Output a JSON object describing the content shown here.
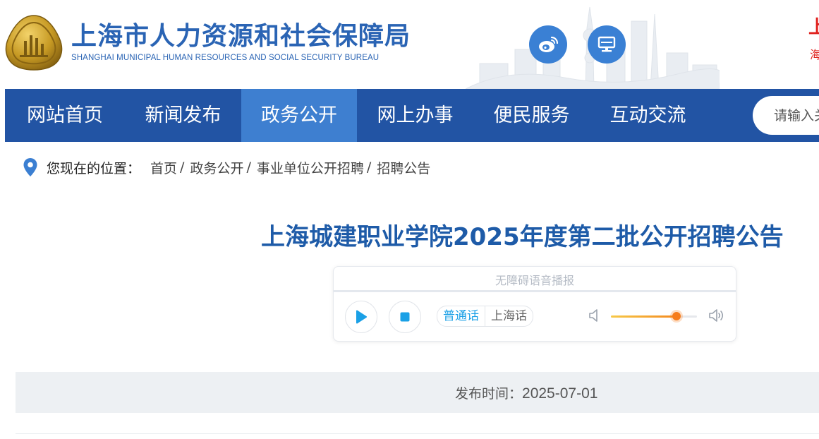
{
  "header": {
    "title_cn": "上海市人力资源和社会保障局",
    "title_en": "SHANGHAI MUNICIPAL HUMAN RESOURCES AND SOCIAL SECURITY BUREAU",
    "weibo_icon": "weibo-icon",
    "desktop_icon": "desktop-monitor-icon",
    "corner_text_1": "上",
    "corner_text_2": "海"
  },
  "nav": {
    "items": [
      {
        "label": "网站首页"
      },
      {
        "label": "新闻发布"
      },
      {
        "label": "政务公开",
        "active": true
      },
      {
        "label": "网上办事"
      },
      {
        "label": "便民服务"
      },
      {
        "label": "互动交流"
      }
    ],
    "search_placeholder": "请输入关键字"
  },
  "breadcrumb": {
    "label": "您现在的位置：",
    "items": [
      "首页",
      "政务公开",
      "事业单位公开招聘",
      "招聘公告"
    ],
    "separator": "/"
  },
  "article": {
    "title": "上海城建职业学院2025年度第二批公开招聘公告",
    "publish_label": "发布时间：",
    "publish_date": "2025-07-01"
  },
  "audio": {
    "title": "无障碍语音播报",
    "progress": 0,
    "languages": [
      "普通话",
      "上海话"
    ],
    "selected_language": "普通话",
    "volume": 0.76,
    "play_icon": "play-icon",
    "stop_icon": "stop-icon",
    "volume_low_icon": "volume-low-icon",
    "volume_high_icon": "volume-high-icon"
  },
  "colors": {
    "brand_blue": "#2a64b4",
    "nav_bg": "#2254a4",
    "nav_active": "#3e7fd0",
    "title_blue": "#1e5ba8",
    "accent_cyan": "#1aa0e6",
    "volume_orange": "#f67c1c"
  }
}
